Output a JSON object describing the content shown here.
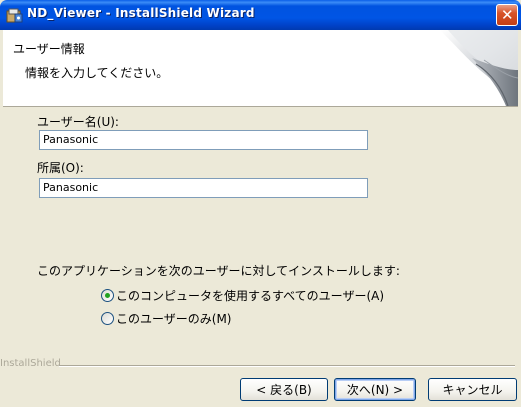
{
  "window": {
    "title": "ND_Viewer - InstallShield Wizard",
    "close_label": "✕"
  },
  "header": {
    "title": "ユーザー情報",
    "subtitle": "情報を入力してください。"
  },
  "form": {
    "username_label": "ユーザー名(U):",
    "username_value": "Panasonic",
    "org_label": "所属(O):",
    "org_value": "Panasonic"
  },
  "install_for": {
    "prompt": "このアプリケーションを次のユーザーに対してインストールします:",
    "options": [
      {
        "label": "このコンピュータを使用するすべてのユーザー(A)",
        "selected": true
      },
      {
        "label": "このユーザーのみ(M)",
        "selected": false
      }
    ]
  },
  "footer": {
    "brand": "InstallShield",
    "back_label": "< 戻る(B)",
    "next_label": "次へ(N) >",
    "cancel_label": "キャンセル"
  },
  "colors": {
    "titlebar": "#0055e5",
    "face": "#ece9d8",
    "radio_dot": "#21a121"
  },
  "icons": [
    "installer-icon",
    "close-icon",
    "radio-selected-icon",
    "radio-unselected-icon",
    "header-graphic"
  ]
}
